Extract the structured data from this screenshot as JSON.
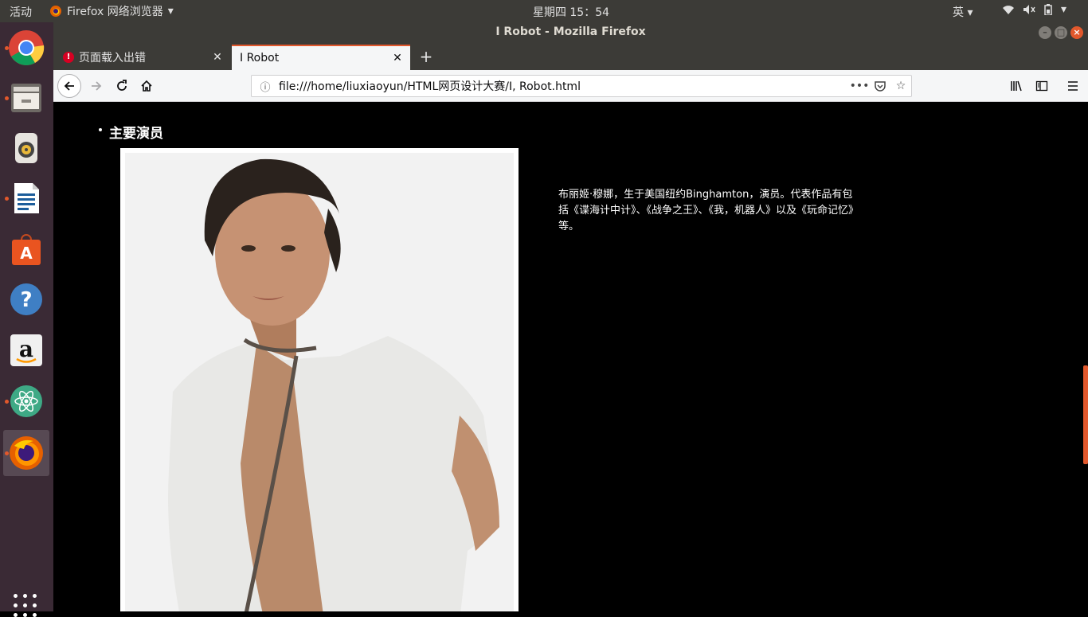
{
  "system_bar": {
    "activities": "活动",
    "app_name": "Firefox 网络浏览器",
    "clock": "星期四 15：54",
    "input_method": "英"
  },
  "window": {
    "title": "I Robot - Mozilla Firefox"
  },
  "tabs": [
    {
      "label": "页面载入出错",
      "state": "error"
    },
    {
      "label": "I Robot",
      "state": "active"
    }
  ],
  "navbar": {
    "url": "file:///home/liuxiaoyun/HTML网页设计大赛/I, Robot.html"
  },
  "page": {
    "heading": "主要演员",
    "bio": "布丽姬·穆娜，生于美国纽约Binghamton，演员。代表作品有包括《谍海计中计》、《战争之王》、《我，机器人》以及《玩命记忆》等。"
  },
  "launcher": {
    "apps": [
      "chrome-icon",
      "files-icon",
      "rhythmbox-icon",
      "writer-icon",
      "software-center-icon",
      "help-icon",
      "amazon-icon",
      "atom-icon",
      "firefox-icon"
    ]
  },
  "colors": {
    "accent": "#e2582c",
    "panel": "#3c3b37",
    "launcher": "#3a2a35"
  }
}
